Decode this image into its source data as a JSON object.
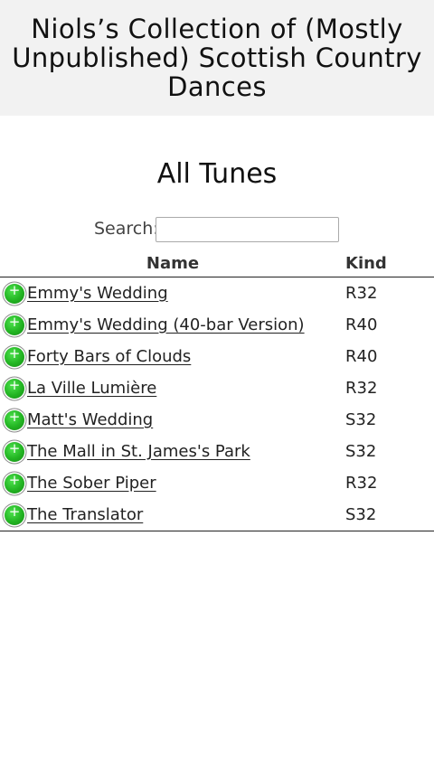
{
  "header": {
    "site_title": "Niols’s Collection of (Mostly Unpublished) Scottish Country Dances"
  },
  "page": {
    "title": "All Tunes"
  },
  "search": {
    "label": "Search:",
    "value": "",
    "placeholder": ""
  },
  "table": {
    "columns": {
      "name": "Name",
      "kind": "Kind"
    },
    "expand_glyph": "+",
    "rows": [
      {
        "name": "Emmy's Wedding",
        "kind": "R32"
      },
      {
        "name": "Emmy's Wedding (40-bar Version)",
        "kind": "R40"
      },
      {
        "name": "Forty Bars of Clouds",
        "kind": "R40"
      },
      {
        "name": "La Ville Lumière",
        "kind": "R32"
      },
      {
        "name": "Matt's Wedding",
        "kind": "S32"
      },
      {
        "name": "The Mall in St. James's Park",
        "kind": "S32"
      },
      {
        "name": "The Sober Piper",
        "kind": "R32"
      },
      {
        "name": "The Translator",
        "kind": "S32"
      }
    ]
  },
  "colors": {
    "header_bg": "#f2f2f2",
    "expand_button": "#22b422"
  },
  "icons": {
    "expand": "plus-circle-icon"
  }
}
